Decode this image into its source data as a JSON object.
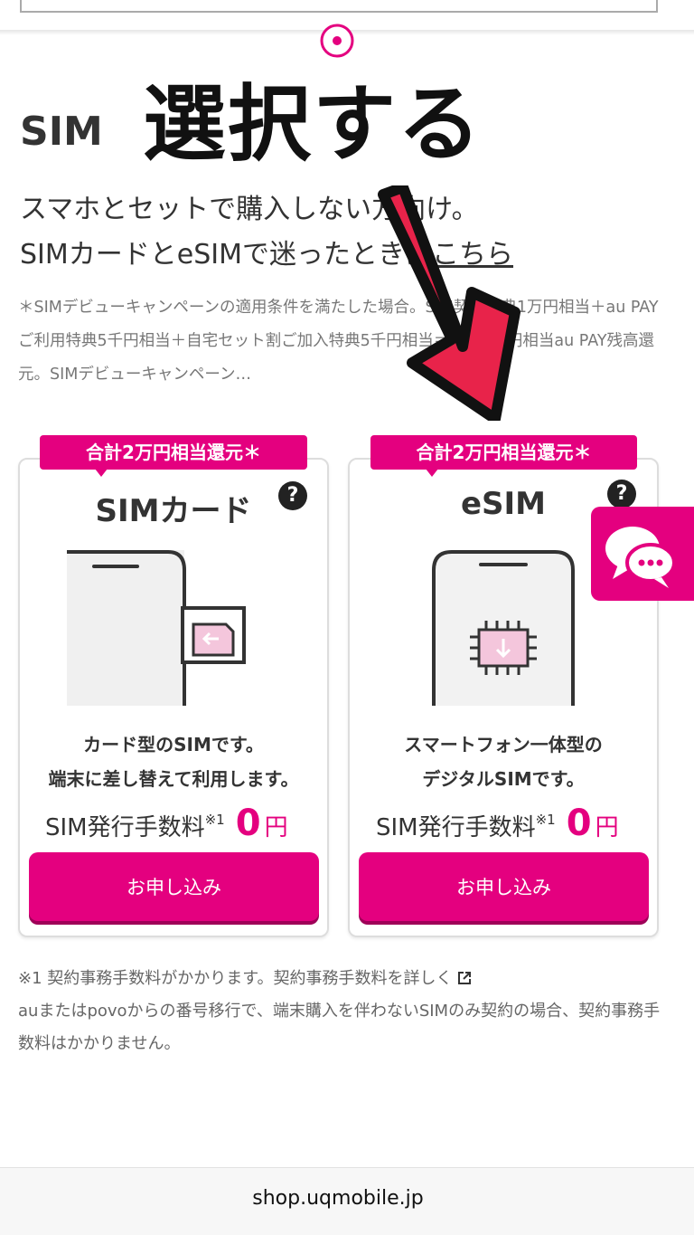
{
  "overlay": {
    "title": "選択する"
  },
  "section": {
    "heading": "SIM",
    "lead_line1": "スマホとセットで購入しない方向け。",
    "lead_line2_prefix": "SIMカードとeSIMで迷ったときは",
    "lead_line2_link": "こちら",
    "campaign_note": "＊SIMデビューキャンペーンの適用条件を満たした場合。SIM契約特典1万円相当＋au PAYご利用特典5千円相当＋自宅セット割ご加入特典5千円相当＝合計2万円相当au PAY残高還元。SIMデビューキャンペーン…"
  },
  "cards": [
    {
      "badge": "合計2万円相当還元＊",
      "title": "SIMカード",
      "help": "?",
      "desc_line1": "カード型のSIMです。",
      "desc_line2": "端末に差し替えて利用します。",
      "fee_label": "SIM発行手数料",
      "fee_note": "※1",
      "fee_value": "0",
      "fee_unit": "円",
      "apply_label": "お申し込み"
    },
    {
      "badge": "合計2万円相当還元＊",
      "title": "eSIM",
      "help": "?",
      "desc_line1": "スマートフォン一体型の",
      "desc_line2": "デジタルSIMです。",
      "fee_label": "SIM発行手数料",
      "fee_note": "※1",
      "fee_value": "0",
      "fee_unit": "円",
      "apply_label": "お申し込み"
    }
  ],
  "footnotes": {
    "line1": "※1 契約事務手数料がかかります。契約事務手数料を詳しく",
    "line2": "auまたはpovoからの番号移行で、端末購入を伴わないSIMのみ契約の場合、契約事務手数料はかかりません。"
  },
  "browser": {
    "url": "shop.uqmobile.jp"
  },
  "colors": {
    "accent": "#e4007f",
    "text": "#333333"
  },
  "icons": [
    "radio-selected-icon",
    "arrow-down-icon",
    "help-icon",
    "chat-icon",
    "external-link-icon",
    "sim-card-phone-icon",
    "esim-phone-icon"
  ]
}
